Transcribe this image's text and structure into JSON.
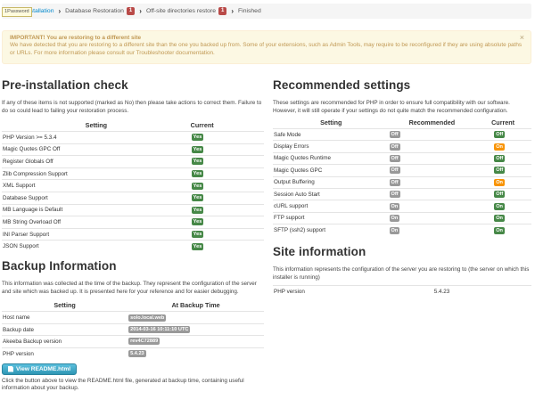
{
  "breadcrumb": {
    "password_tag": "1Password",
    "step1": "Installation",
    "step2": "Database Restoration",
    "step2_badge": "1",
    "step3": "Off-site directories restore",
    "step3_badge": "1",
    "step4": "Finished"
  },
  "alert": {
    "title": "IMPORTANT! You are restoring to a different site",
    "body": "We have detected that you are restoring to a different site than the one you backed up from. Some of your extensions, such as Admin Tools, may require to be reconfigured if they are using absolute paths or URLs. For more information please consult our Troubleshooter documentation.",
    "close": "×"
  },
  "preinstall": {
    "title": "Pre-installation check",
    "desc": "If any of these items is not supported (marked as No) then please take actions to correct them. Failure to do so could lead to failing your restoration process.",
    "col_setting": "Setting",
    "col_current": "Current",
    "rows": [
      {
        "name": "PHP Version >= 5.3.4",
        "val": "Yes"
      },
      {
        "name": "Magic Quotes GPC Off",
        "val": "Yes"
      },
      {
        "name": "Register Globals Off",
        "val": "Yes"
      },
      {
        "name": "Zlib Compression Support",
        "val": "Yes"
      },
      {
        "name": "XML Support",
        "val": "Yes"
      },
      {
        "name": "Database Support",
        "val": "Yes"
      },
      {
        "name": "MB Language is Default",
        "val": "Yes"
      },
      {
        "name": "MB String Overload Off",
        "val": "Yes"
      },
      {
        "name": "INI Parser Support",
        "val": "Yes"
      },
      {
        "name": "JSON Support",
        "val": "Yes"
      }
    ]
  },
  "recommended": {
    "title": "Recommended settings",
    "desc": "These settings are recommended for PHP in order to ensure full compatibility with our software. However, it will still operate if your settings do not quite match the recommended configuration.",
    "col_setting": "Setting",
    "col_recommended": "Recommended",
    "col_current": "Current",
    "rows": [
      {
        "name": "Safe Mode",
        "rec": "Off",
        "cur": "Off",
        "cur_color": "green"
      },
      {
        "name": "Display Errors",
        "rec": "Off",
        "cur": "On",
        "cur_color": "orange"
      },
      {
        "name": "Magic Quotes Runtime",
        "rec": "Off",
        "cur": "Off",
        "cur_color": "green"
      },
      {
        "name": "Magic Quotes GPC",
        "rec": "Off",
        "cur": "Off",
        "cur_color": "green"
      },
      {
        "name": "Output Buffering",
        "rec": "Off",
        "cur": "On",
        "cur_color": "orange"
      },
      {
        "name": "Session Auto Start",
        "rec": "Off",
        "cur": "Off",
        "cur_color": "green"
      },
      {
        "name": "cURL support",
        "rec": "On",
        "cur": "On",
        "cur_color": "green"
      },
      {
        "name": "FTP support",
        "rec": "On",
        "cur": "On",
        "cur_color": "green"
      },
      {
        "name": "SFTP (ssh2) support",
        "rec": "On",
        "cur": "On",
        "cur_color": "green"
      }
    ]
  },
  "backup": {
    "title": "Backup Information",
    "desc": "This information was collected at the time of the backup. They represent the configuration of the server and site which was backed up. It is presented here for your reference and for easier debugging.",
    "col_setting": "Setting",
    "col_time": "At Backup Time",
    "rows": [
      {
        "name": "Host name",
        "val": "solo.local.web"
      },
      {
        "name": "Backup date",
        "val": "2014-03-16 10:11:10 UTC"
      },
      {
        "name": "Akeeba Backup version",
        "val": "rev4C72889"
      },
      {
        "name": "PHP version",
        "val": "5.4.23"
      }
    ],
    "button": "View README.html",
    "footer": "Click the button above to view the README.html file, generated at backup time, containing useful information about your backup."
  },
  "site": {
    "title": "Site information",
    "desc": "This information represents the configuration of the server you are restoring to (the server on which this installer is running)",
    "rows": [
      {
        "name": "PHP version",
        "val": "5.4.23"
      }
    ]
  },
  "colors": {
    "green": "#468847",
    "grey": "#999999",
    "orange": "#f89406",
    "link": "#0088cc",
    "badge": "#b94a48"
  }
}
